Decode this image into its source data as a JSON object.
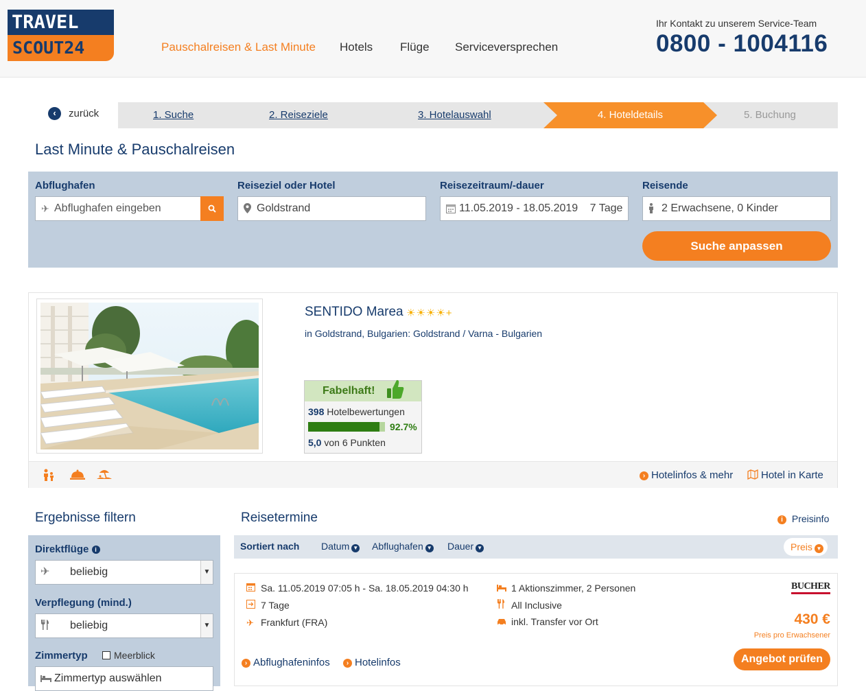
{
  "header": {
    "logo_top": "TRAVEL",
    "logo_bottom": "SCOUT24",
    "nav": [
      "Pauschalreisen & Last Minute",
      "Hotels",
      "Flüge",
      "Serviceversprechen"
    ],
    "contact_label": "Ihr Kontakt zu unserem Service-Team",
    "contact_phone": "0800 - 1004116"
  },
  "stepper": {
    "back": "zurück",
    "steps": [
      "1. Suche",
      "2. Reiseziele",
      "3. Hotelauswahl",
      "4. Hoteldetails",
      "5. Buchung"
    ],
    "active_index": 3
  },
  "page_title": "Last Minute & Pauschalreisen",
  "search": {
    "airport_label": "Abflughafen",
    "airport_placeholder": "Abflughafen eingeben",
    "destination_label": "Reiseziel oder Hotel",
    "destination_value": "Goldstrand",
    "dates_label": "Reisezeitraum/-dauer",
    "dates_value": "11.05.2019 - 18.05.2019",
    "duration_value": "7 Tage",
    "travellers_label": "Reisende",
    "travellers_value": "2 Erwachsene, 0 Kinder",
    "submit": "Suche anpassen"
  },
  "hotel": {
    "name": "SENTIDO Marea",
    "stars": "☀☀☀☀+",
    "location": "in Goldstrand, Bulgarien: Goldstrand / Varna - Bulgarien",
    "rating_label": "Fabelhaft!",
    "reviews_count": "398",
    "reviews_text": "Hotelbewertungen",
    "recommend_pct": "92.7%",
    "recommend_fraction": 0.927,
    "score": "5,0",
    "score_text": "von 6 Punkten",
    "info_link": "Hotelinfos & mehr",
    "map_link": "Hotel in Karte",
    "amenities": [
      "family-icon",
      "service-bell-icon",
      "beach-icon"
    ]
  },
  "filter": {
    "title": "Ergebnisse filtern",
    "direct_label": "Direktflüge",
    "direct_value": "beliebig",
    "board_label": "Verpflegung (mind.)",
    "board_value": "beliebig",
    "room_label": "Zimmertyp",
    "seaview_label": "Meerblick",
    "room_placeholder": "Zimmertyp auswählen"
  },
  "results": {
    "title": "Reisetermine",
    "price_info": "Preisinfo",
    "sort_label": "Sortiert nach",
    "sort_options": [
      "Datum",
      "Abflughafen",
      "Dauer"
    ],
    "sort_active": "Preis"
  },
  "offer": {
    "dates": "Sa. 11.05.2019 07:05 h - Sa. 18.05.2019 04:30 h",
    "duration": "7 Tage",
    "airport": "Frankfurt (FRA)",
    "room": "1 Aktionszimmer, 2 Personen",
    "board": "All Inclusive",
    "transfer": "inkl. Transfer vor Ort",
    "operator": "BUCHER",
    "price": "430 €",
    "price_note": "Preis pro Erwachsener",
    "airport_info": "Abflughafeninfos",
    "hotel_info": "Hotelinfos",
    "cta": "Angebot prüfen"
  },
  "colors": {
    "brand_blue": "#173b6c",
    "brand_orange": "#f47f20",
    "search_bg": "#c0cedd",
    "rating_green": "#2e7d12"
  }
}
